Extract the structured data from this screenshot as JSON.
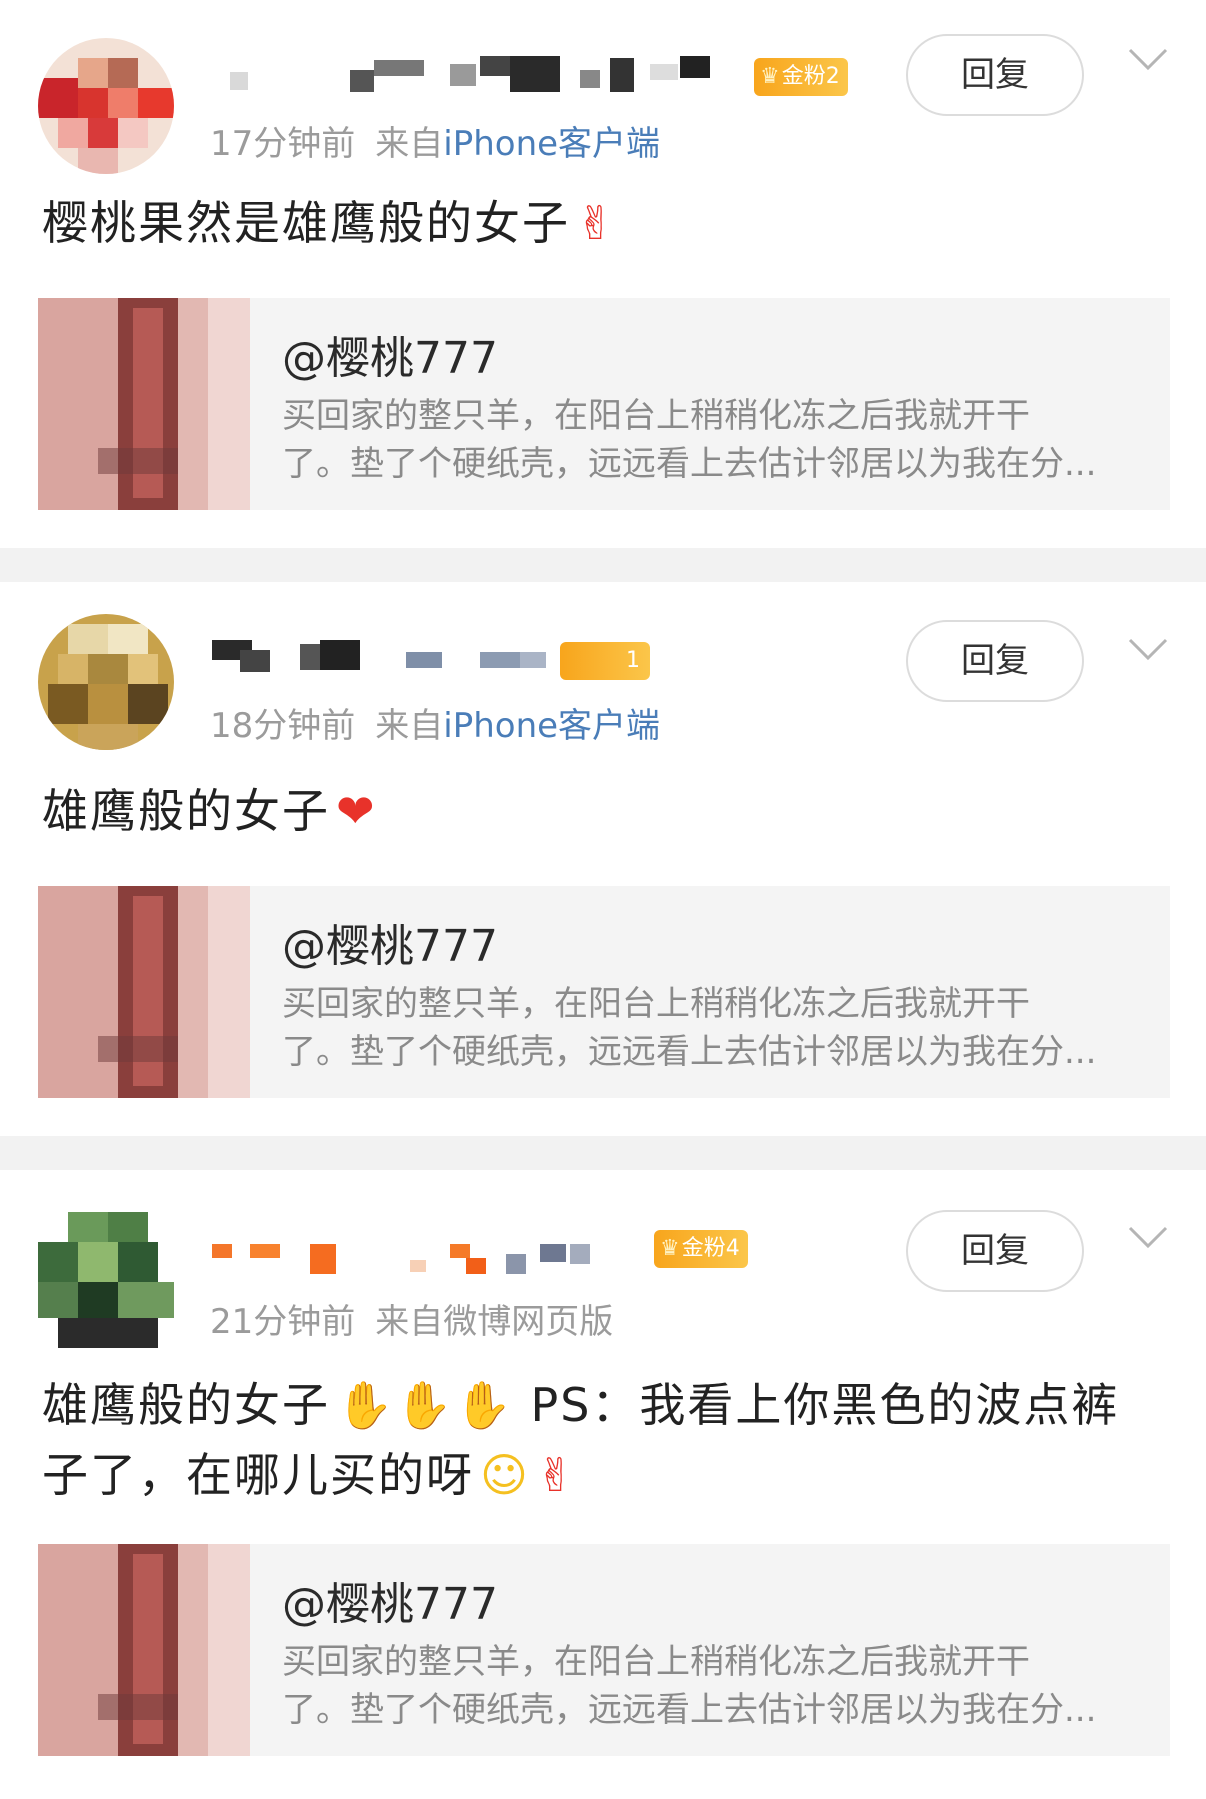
{
  "posts": [
    {
      "badge": "金粉2",
      "time": "17分钟前",
      "source_prefix": "来自",
      "source_client": "iPhone客户端",
      "reply_label": "回复",
      "text": "樱桃果然是雄鹰般的女子",
      "emoji": [
        "finger-heart"
      ],
      "card": {
        "title": "@樱桃777",
        "desc_line1": "买回家的整只羊，在阳台上稍稍化冻之后我就开干",
        "desc_line2": "了。垫了个硬纸壳，远远看上去估计邻居以为我在分..."
      }
    },
    {
      "badge": "1",
      "time": "18分钟前",
      "source_prefix": "来自",
      "source_client": "iPhone客户端",
      "reply_label": "回复",
      "text": "雄鹰般的女子",
      "emoji": [
        "red-heart"
      ],
      "card": {
        "title": "@樱桃777",
        "desc_line1": "买回家的整只羊，在阳台上稍稍化冻之后我就开干",
        "desc_line2": "了。垫了个硬纸壳，远远看上去估计邻居以为我在分..."
      }
    },
    {
      "badge": "金粉4",
      "time": "21分钟前",
      "source_prefix": "来自",
      "source_client": "微博网页版",
      "reply_label": "回复",
      "text_line1": "雄鹰般的女子",
      "text_line1_suffix": "PS：我看上你黑色的波点裤",
      "text_line2": "子了，在哪儿买的呀",
      "emoji": [
        "clapping-hands",
        "clapping-hands",
        "clapping-hands",
        "blushing-face",
        "finger-heart"
      ],
      "card": {
        "title": "@樱桃777",
        "desc_line1": "买回家的整只羊，在阳台上稍稍化冻之后我就开干",
        "desc_line2": "了。垫了个硬纸壳，远远看上去估计邻居以为我在分..."
      }
    }
  ],
  "colors": {
    "background": "#f2f2f2",
    "card": "#f4f4f4",
    "link_blue": "#4a7db8",
    "badge_gold": "#f8a51c",
    "meta_gray": "#9b9b9b"
  }
}
